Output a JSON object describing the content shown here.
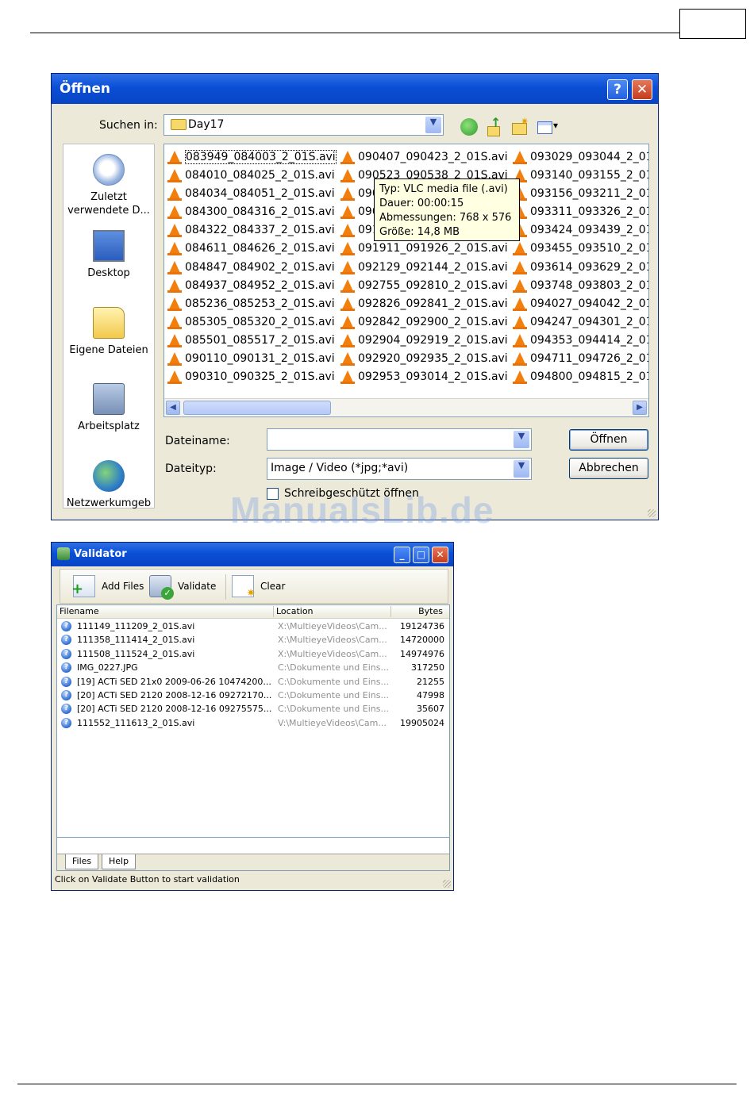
{
  "open_dialog": {
    "title": "Öffnen",
    "help_button": "?",
    "close_button": "✕",
    "lookin_label": "Suchen in:",
    "lookin_value": "Day17",
    "places": [
      {
        "label": "Zuletzt verwendete D...",
        "icon": "recent-documents-icon"
      },
      {
        "label": "Desktop",
        "icon": "desktop-icon"
      },
      {
        "label": "Eigene Dateien",
        "icon": "my-documents-icon"
      },
      {
        "label": "Arbeitsplatz",
        "icon": "my-computer-icon"
      },
      {
        "label": "Netzwerkumgeb",
        "icon": "network-places-icon"
      }
    ],
    "files": {
      "col1": [
        "083949_084003_2_01S.avi",
        "084010_084025_2_01S.avi",
        "084034_084051_2_01S.avi",
        "084300_084316_2_01S.avi",
        "084322_084337_2_01S.avi",
        "084611_084626_2_01S.avi",
        "084847_084902_2_01S.avi",
        "084937_084952_2_01S.avi",
        "085236_085253_2_01S.avi",
        "085305_085320_2_01S.avi",
        "085501_085517_2_01S.avi",
        "090110_090131_2_01S.avi",
        "090310_090325_2_01S.avi"
      ],
      "col2": [
        "090407_090423_2_01S.avi",
        "090523_090538_2_01S.avi",
        "090",
        "090",
        "091",
        "091911_091926_2_01S.avi",
        "092129_092144_2_01S.avi",
        "092755_092810_2_01S.avi",
        "092826_092841_2_01S.avi",
        "092842_092900_2_01S.avi",
        "092904_092919_2_01S.avi",
        "092920_092935_2_01S.avi",
        "092953_093014_2_01S.avi"
      ],
      "col3": [
        "093029_093044_2_01",
        "093140_093155_2_01",
        "093156_093211_2_01",
        "093311_093326_2_01",
        "093424_093439_2_01",
        "093455_093510_2_01",
        "093614_093629_2_01",
        "093748_093803_2_01",
        "094027_094042_2_01",
        "094247_094301_2_01",
        "094353_094414_2_01",
        "094711_094726_2_01",
        "094800_094815_2_01"
      ]
    },
    "tooltip": {
      "type": "Typ: VLC media file (.avi)",
      "duration": "Dauer: 00:00:15",
      "dimensions": "Abmessungen: 768 x 576",
      "size": "Größe: 14,8 MB"
    },
    "filename_label": "Dateiname:",
    "filename_value": "",
    "filetype_label": "Dateityp:",
    "filetype_value": "Image / Video (*jpg;*avi)",
    "open_button": "Öffnen",
    "cancel_button": "Abbrechen",
    "readonly_label": "Schreibgeschützt öffnen",
    "readonly_checked": false
  },
  "watermark": "ManualsLib.de",
  "validator": {
    "title": "Validator",
    "toolbar": {
      "add_files": "Add Files",
      "validate": "Validate",
      "clear": "Clear"
    },
    "columns": {
      "filename": "Filename",
      "location": "Location",
      "bytes": "Bytes"
    },
    "rows": [
      {
        "filename": "111149_111209_2_01S.avi",
        "location": "X:\\MultieyeVideos\\Cam...",
        "bytes": "19124736"
      },
      {
        "filename": "111358_111414_2_01S.avi",
        "location": "X:\\MultieyeVideos\\Cam...",
        "bytes": "14720000"
      },
      {
        "filename": "111508_111524_2_01S.avi",
        "location": "X:\\MultieyeVideos\\Cam...",
        "bytes": "14974976"
      },
      {
        "filename": "IMG_0227.JPG",
        "location": "C:\\Dokumente und Eins...",
        "bytes": "317250"
      },
      {
        "filename": "[19] ACTi SED 21x0 2009-06-26 10474200...",
        "location": "C:\\Dokumente und Eins...",
        "bytes": "21255"
      },
      {
        "filename": "[20] ACTi SED 2120 2008-12-16 09272170...",
        "location": "C:\\Dokumente und Eins...",
        "bytes": "47998"
      },
      {
        "filename": "[20] ACTi SED 2120 2008-12-16 09275575...",
        "location": "C:\\Dokumente und Eins...",
        "bytes": "35607"
      },
      {
        "filename": "111552_111613_2_01S.avi",
        "location": "V:\\MultieyeVideos\\Cam...",
        "bytes": "19905024"
      }
    ],
    "tabs": [
      "Files",
      "Help"
    ],
    "status": "Click on Validate Button to start validation"
  }
}
